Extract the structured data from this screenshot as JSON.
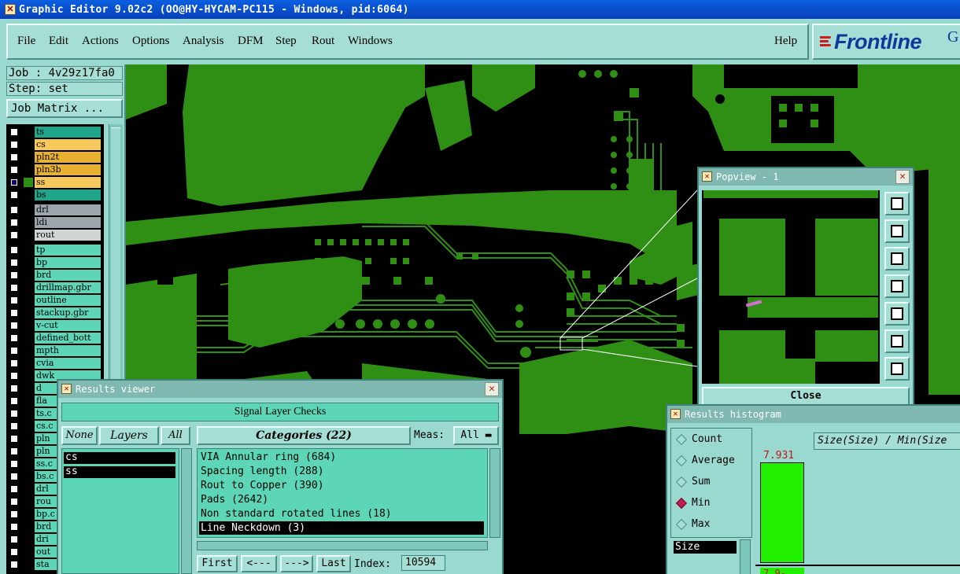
{
  "window": {
    "title": "Graphic Editor 9.02c2 (OO@HY-HYCAM-PC115 - Windows, pid:6064)"
  },
  "menu": {
    "items": [
      "File",
      "Edit",
      "Actions",
      "Options",
      "Analysis",
      "DFM",
      "Step",
      "Rout",
      "Windows"
    ],
    "help": "Help"
  },
  "logo": {
    "text": "Frontline",
    "suffix": "G"
  },
  "left_panel": {
    "job": "Job : 4v29z17fa0",
    "step": "Step: set",
    "job_matrix_label": "Job Matrix ..."
  },
  "layers": [
    {
      "name": "ts",
      "color": "#1fa58b",
      "checked": false
    },
    {
      "name": "cs",
      "color": "#f7c95d",
      "checked": false
    },
    {
      "name": "pln2t",
      "color": "#e8b231",
      "checked": false
    },
    {
      "name": "pln3b",
      "color": "#e8b231",
      "checked": false
    },
    {
      "name": "ss",
      "color": "#f7c95d",
      "checked": true
    },
    {
      "name": "bs",
      "color": "#1fa58b",
      "checked": false
    },
    {
      "name": "drl",
      "color": "#9aa6ab",
      "checked": false
    },
    {
      "name": "ldi",
      "color": "#9aa6ab",
      "checked": false
    },
    {
      "name": "rout",
      "color": "#d0d6d6",
      "checked": false
    },
    {
      "name": "tp",
      "color": "#5dd6b8",
      "checked": false
    },
    {
      "name": "bp",
      "color": "#5dd6b8",
      "checked": false
    },
    {
      "name": "brd",
      "color": "#5dd6b8",
      "checked": false
    },
    {
      "name": "drillmap.gbr",
      "color": "#5dd6b8",
      "checked": false
    },
    {
      "name": "outline",
      "color": "#5dd6b8",
      "checked": false
    },
    {
      "name": "stackup.gbr",
      "color": "#5dd6b8",
      "checked": false
    },
    {
      "name": "v-cut",
      "color": "#5dd6b8",
      "checked": false
    },
    {
      "name": "defined_bott",
      "color": "#5dd6b8",
      "checked": false
    },
    {
      "name": "mpth",
      "color": "#5dd6b8",
      "checked": false
    },
    {
      "name": "cvia",
      "color": "#5dd6b8",
      "checked": false
    },
    {
      "name": "dwk",
      "color": "#5dd6b8",
      "checked": false
    },
    {
      "name": "d",
      "color": "#5dd6b8",
      "checked": false
    },
    {
      "name": "fla",
      "color": "#5dd6b8",
      "checked": false
    },
    {
      "name": "ts.c",
      "color": "#5dd6b8",
      "checked": false
    },
    {
      "name": "cs.c",
      "color": "#5dd6b8",
      "checked": false
    },
    {
      "name": "pln",
      "color": "#5dd6b8",
      "checked": false
    },
    {
      "name": "pln",
      "color": "#5dd6b8",
      "checked": false
    },
    {
      "name": "ss.c",
      "color": "#5dd6b8",
      "checked": false
    },
    {
      "name": "bs.c",
      "color": "#5dd6b8",
      "checked": false
    },
    {
      "name": "drl",
      "color": "#5dd6b8",
      "checked": false
    },
    {
      "name": "rou",
      "color": "#5dd6b8",
      "checked": false
    },
    {
      "name": "bp.c",
      "color": "#5dd6b8",
      "checked": false
    },
    {
      "name": "brd",
      "color": "#5dd6b8",
      "checked": false
    },
    {
      "name": "dri",
      "color": "#5dd6b8",
      "checked": false
    },
    {
      "name": "out",
      "color": "#5dd6b8",
      "checked": false
    },
    {
      "name": "sta",
      "color": "#5dd6b8",
      "checked": false
    }
  ],
  "popview": {
    "title": "Popview - 1",
    "close_label": "Close"
  },
  "results_viewer": {
    "title": "Results viewer",
    "header": "Signal Layer Checks",
    "none_label": "None",
    "layers_label": "Layers",
    "all_label": "All",
    "categories_label": "Categories (22)",
    "meas_label": "Meas:",
    "meas_value": "All",
    "layers": [
      "cs",
      "ss"
    ],
    "categories": [
      "VIA Annular ring (684)",
      "Spacing length (288)",
      "Rout to Copper (390)",
      "Pads (2642)",
      "Non standard rotated lines (18)",
      "Line Neckdown (3)"
    ],
    "selected_category": "Line Neckdown (3)",
    "nav": {
      "first": "First",
      "prev": "<---",
      "next": "--->",
      "last": "Last",
      "index_label": "Index:",
      "index_value": "10594"
    }
  },
  "results_histogram": {
    "title": "Results histogram",
    "options": [
      "Count",
      "Average",
      "Sum",
      "Min",
      "Max"
    ],
    "selected": "Min",
    "size_label": "Size",
    "plot_title": "Size(Size) / Min(Size",
    "bar_value": "7.931",
    "bar_xlabel": "7.9-"
  },
  "colors": {
    "copper": "#2f8f14",
    "background": "#000000",
    "panel": "#9ad9d0"
  }
}
